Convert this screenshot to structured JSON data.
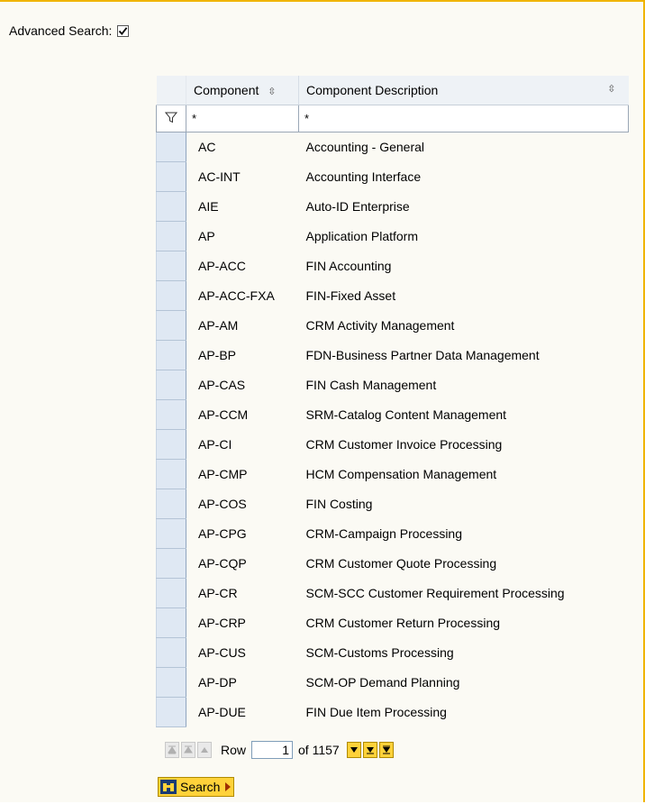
{
  "advanced_search": {
    "label": "Advanced Search:",
    "checked": true
  },
  "table": {
    "columns": {
      "component": "Component",
      "description": "Component Description"
    },
    "filter": {
      "component": "*",
      "description": "*"
    },
    "rows": [
      {
        "component": "AC",
        "description": "Accounting - General"
      },
      {
        "component": "AC-INT",
        "description": "Accounting Interface"
      },
      {
        "component": "AIE",
        "description": "Auto-ID Enterprise"
      },
      {
        "component": "AP",
        "description": "Application Platform"
      },
      {
        "component": "AP-ACC",
        "description": "FIN Accounting"
      },
      {
        "component": "AP-ACC-FXA",
        "description": "FIN-Fixed Asset"
      },
      {
        "component": "AP-AM",
        "description": "CRM Activity Management"
      },
      {
        "component": "AP-BP",
        "description": "FDN-Business Partner Data Management"
      },
      {
        "component": "AP-CAS",
        "description": "FIN Cash Management"
      },
      {
        "component": "AP-CCM",
        "description": "SRM-Catalog Content Management"
      },
      {
        "component": "AP-CI",
        "description": "CRM Customer Invoice Processing"
      },
      {
        "component": "AP-CMP",
        "description": "HCM Compensation Management"
      },
      {
        "component": "AP-COS",
        "description": "FIN Costing"
      },
      {
        "component": "AP-CPG",
        "description": "CRM-Campaign Processing"
      },
      {
        "component": "AP-CQP",
        "description": "CRM Customer Quote Processing"
      },
      {
        "component": "AP-CR",
        "description": "SCM-SCC Customer Requirement Processing"
      },
      {
        "component": "AP-CRP",
        "description": "CRM Customer Return Processing"
      },
      {
        "component": "AP-CUS",
        "description": "SCM-Customs Processing"
      },
      {
        "component": "AP-DP",
        "description": "SCM-OP Demand Planning"
      },
      {
        "component": "AP-DUE",
        "description": "FIN Due Item Processing"
      }
    ]
  },
  "pager": {
    "row_label": "Row",
    "row_value": "1",
    "of_label": "of 1157"
  },
  "search_button": {
    "label": "Search"
  },
  "icons": {
    "filter": "funnel-icon",
    "sort": "sort-arrows-icon",
    "first": "first-page-icon",
    "prev_page": "previous-page-icon",
    "prev_row": "previous-row-icon",
    "next_row": "next-row-icon",
    "next_page": "next-page-icon",
    "last": "last-page-icon",
    "search": "binoculars-icon"
  },
  "colors": {
    "accent": "#f0b400",
    "selector": "#dfe8f3",
    "button": "#ffd23a"
  }
}
